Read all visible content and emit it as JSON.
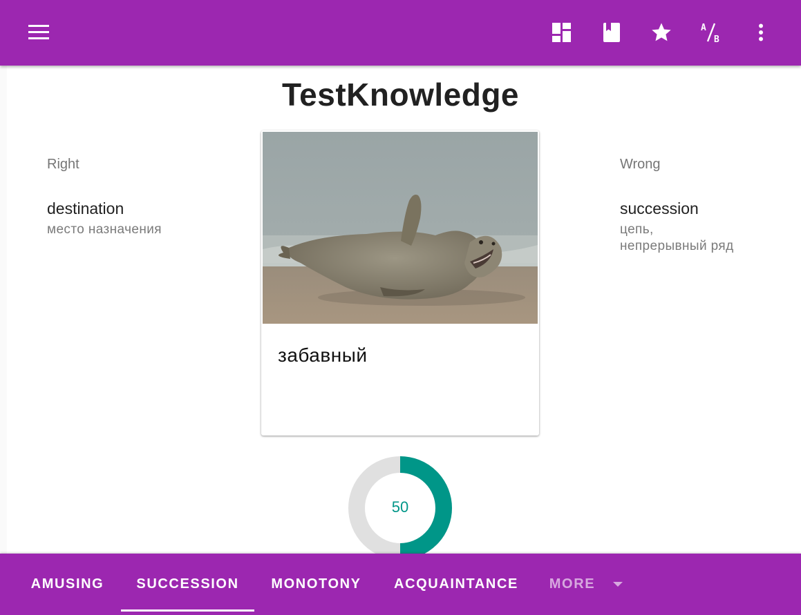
{
  "appbar": {
    "icons": [
      "menu-icon",
      "dashboard-icon",
      "book-icon",
      "star-icon",
      "ab-testing-icon",
      "more-vert-icon"
    ],
    "color": "#9c27b0"
  },
  "page": {
    "title": "TestKnowledge"
  },
  "right": {
    "label": "Right",
    "word": "destination",
    "translation": "место назначения"
  },
  "wrong": {
    "label": "Wrong",
    "word": "succession",
    "translation_line1": "цепь,",
    "translation_line2": "непрерывный ряд"
  },
  "card": {
    "word": "забавный"
  },
  "progress": {
    "value": "50",
    "percent": 50,
    "color": "#009688",
    "track_color": "#e0e0e0"
  },
  "tabs": {
    "items": [
      "AMUSING",
      "SUCCESSION",
      "MONOTONY",
      "ACQUAINTANCE"
    ],
    "selected": "SUCCESSION",
    "more_label": "MORE"
  }
}
